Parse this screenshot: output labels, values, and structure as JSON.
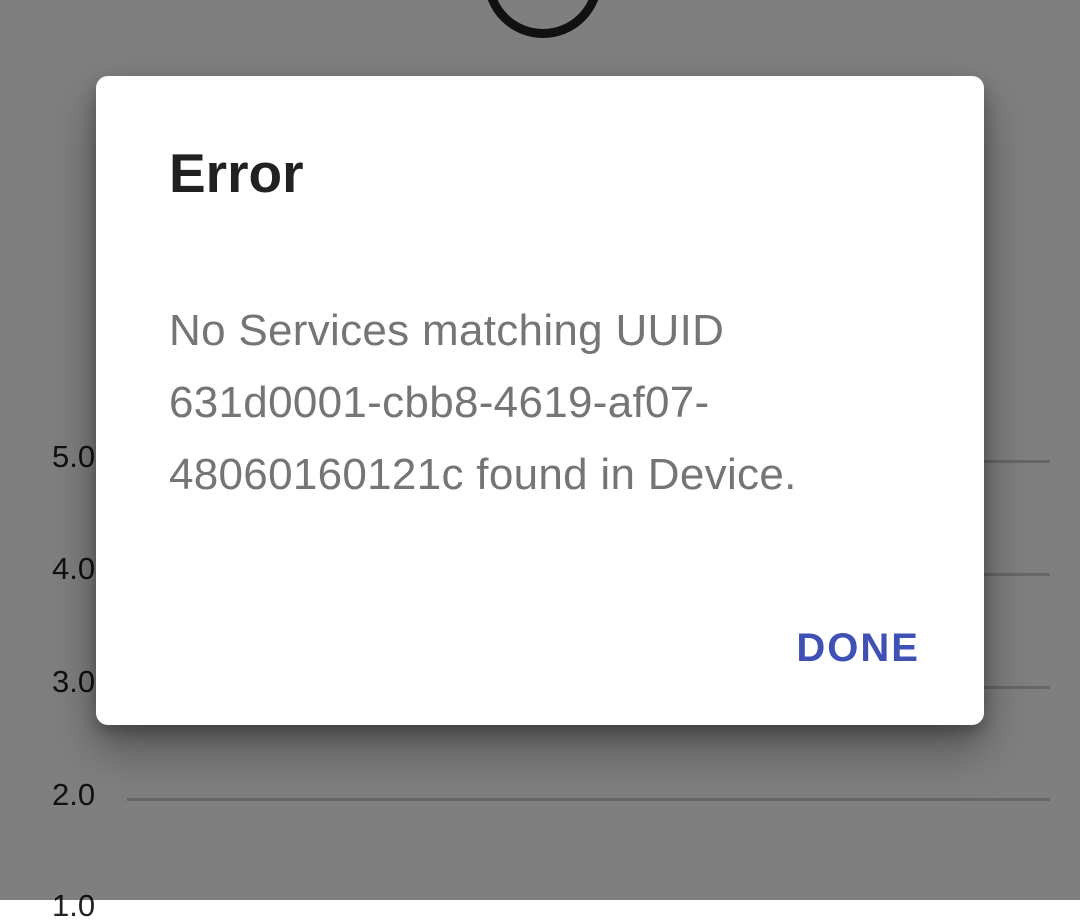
{
  "background_chart": {
    "y_ticks": [
      "5.0",
      "4.0",
      "3.0",
      "2.0",
      "1.0"
    ]
  },
  "dialog": {
    "title": "Error",
    "message": "No Services matching UUID 631d0001-cbb8-4619-af07-48060160121c found in Device.",
    "done_label": "DONE"
  },
  "colors": {
    "accent": "#3f51b5",
    "scrim": "rgba(0,0,0,0.5)",
    "title_text": "#212121",
    "message_text": "#757575"
  }
}
